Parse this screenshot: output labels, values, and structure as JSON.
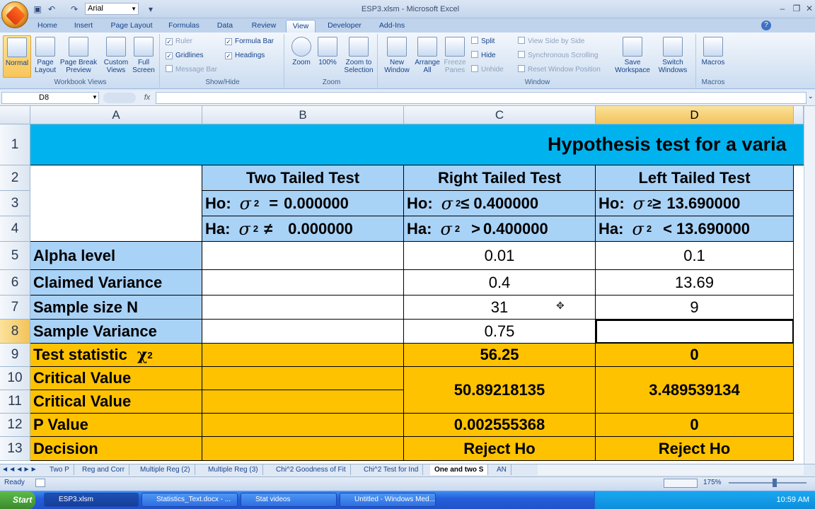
{
  "window": {
    "title": "ESP3.xlsm - Microsoft Excel"
  },
  "qat": {
    "font_name": "Arial"
  },
  "ribbon": {
    "tabs": [
      "Home",
      "Insert",
      "Page Layout",
      "Formulas",
      "Data",
      "Review",
      "View",
      "Developer",
      "Add-Ins"
    ],
    "active_tab": "View",
    "groups": {
      "workbook_views": {
        "label": "Workbook Views",
        "buttons": [
          "Normal",
          "Page Layout",
          "Page Break Preview",
          "Custom Views",
          "Full Screen"
        ]
      },
      "show_hide": {
        "label": "Show/Hide",
        "items": [
          {
            "label": "Ruler",
            "checked": true,
            "enabled": false
          },
          {
            "label": "Formula Bar",
            "checked": true,
            "enabled": true
          },
          {
            "label": "Gridlines",
            "checked": true,
            "enabled": true
          },
          {
            "label": "Headings",
            "checked": true,
            "enabled": true
          },
          {
            "label": "Message Bar",
            "checked": false,
            "enabled": false
          }
        ]
      },
      "zoom": {
        "label": "Zoom",
        "buttons": [
          "Zoom",
          "100%",
          "Zoom to Selection"
        ]
      },
      "window": {
        "label": "Window",
        "buttons": [
          "New Window",
          "Arrange All",
          "Freeze Panes"
        ],
        "small": [
          "Split",
          "Hide",
          "Unhide",
          "View Side by Side",
          "Synchronous Scrolling",
          "Reset Window Position"
        ],
        "big2": [
          "Save Workspace",
          "Switch Windows"
        ]
      },
      "macros": {
        "label": "Macros",
        "buttons": [
          "Macros"
        ]
      }
    }
  },
  "formula_bar": {
    "name_box": "D8",
    "fx": "fx",
    "value": ""
  },
  "columns": [
    "A",
    "B",
    "C",
    "D"
  ],
  "rows": [
    "1",
    "2",
    "3",
    "4",
    "5",
    "6",
    "7",
    "8",
    "9",
    "10",
    "11",
    "12",
    "13"
  ],
  "sheet": {
    "title": "Hypothesis test for a varia",
    "headers": [
      "Two Tailed Test",
      "Right Tailed Test",
      "Left Tailed Test"
    ],
    "ho": [
      {
        "prefix": "Ho:",
        "sup": "2",
        "op": "=",
        "value": "0.000000"
      },
      {
        "prefix": "Ho:",
        "sup": "2",
        "op": "≤",
        "value": "0.400000"
      },
      {
        "prefix": "Ho:",
        "sup": "2",
        "op": "≥",
        "value": "13.690000"
      }
    ],
    "ha": [
      {
        "prefix": "Ha:",
        "sup": "2",
        "op": "≠",
        "value": "0.000000"
      },
      {
        "prefix": "Ha:",
        "sup": "2",
        "op": ">",
        "value": "0.400000"
      },
      {
        "prefix": "Ha:",
        "sup": "2",
        "op": "<",
        "value": "13.690000"
      }
    ],
    "labels": {
      "alpha": "Alpha level",
      "claimed": "Claimed Variance",
      "n": "Sample size N",
      "sample_var": "Sample Variance",
      "test_stat": "Test statistic",
      "chi": "χ",
      "chi_sup": "2",
      "crit1": "Critical Value",
      "crit2": "Critical Value",
      "pvalue": "P Value",
      "decision": "Decision"
    },
    "right": {
      "alpha": "0.01",
      "claimed": "0.4",
      "n": "31",
      "sample_var": "0.75",
      "test_stat": "56.25",
      "critical": "50.89218135",
      "pvalue": "0.002555368",
      "decision": "Reject Ho"
    },
    "left": {
      "alpha": "0.1",
      "claimed": "13.69",
      "n": "9",
      "sample_var": "",
      "test_stat": "0",
      "critical": "3.489539134",
      "pvalue": "0",
      "decision": "Reject Ho"
    }
  },
  "sheet_tabs": [
    "Two P",
    "Reg and Corr",
    "Multiple Reg (2)",
    "Multiple Reg (3)",
    "Chi^2 Goodness of Fit",
    "Chi^2 Test for Ind",
    "One and two S",
    "AN"
  ],
  "active_sheet_tab": "One and two S",
  "status": {
    "ready": "Ready",
    "zoom": "175%"
  },
  "taskbar": {
    "start": "Start",
    "items": [
      "ESP3.xlsm",
      "Statistics_Text.docx - ...",
      "Stat videos",
      "Untitled - Windows Med..."
    ],
    "clock": "10:59 AM"
  }
}
